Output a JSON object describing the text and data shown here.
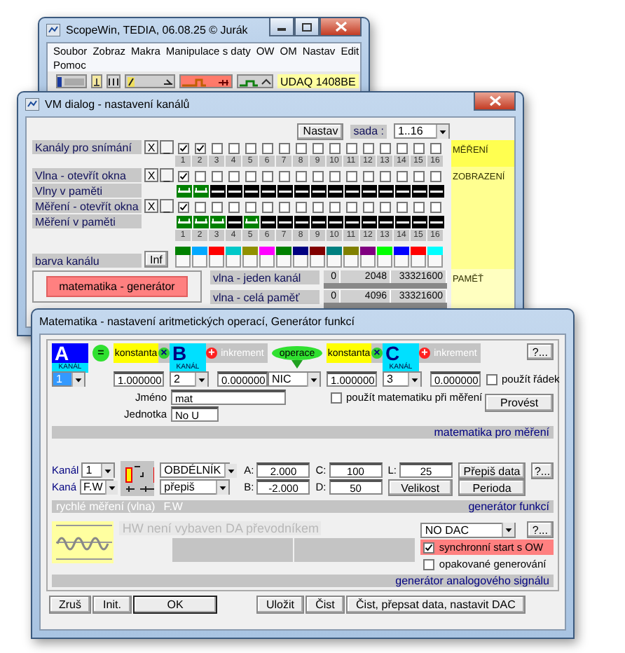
{
  "main_window": {
    "title": "ScopeWin, TEDIA,   06.08.25 © Jurák",
    "menu_rows": [
      {
        "items": [
          "Soubor",
          "Zobraz",
          "Makra",
          "Manipulace s daty",
          "OW",
          "OM",
          "Nastav",
          "Edit"
        ]
      },
      {
        "items": [
          "Pomoc"
        ]
      }
    ],
    "device": "UDAQ 1408BE"
  },
  "channels_dialog": {
    "title": "VM dialog - nastavení kanálů",
    "set_button": "Nastav",
    "set_label": "sada :",
    "set_value": "1..16",
    "rows": [
      {
        "kind": "checks",
        "label": "Kanály pro snímání",
        "buttons": [
          "X",
          "_"
        ],
        "cells": [
          {
            "checked": true
          },
          {
            "checked": true
          },
          {
            "checked": false
          },
          {
            "checked": false
          },
          {
            "checked": false
          },
          {
            "checked": false
          },
          {
            "checked": false
          },
          {
            "checked": false
          },
          {
            "checked": false
          },
          {
            "checked": false
          },
          {
            "checked": false
          },
          {
            "checked": false
          },
          {
            "checked": false
          },
          {
            "checked": false
          },
          {
            "checked": false
          },
          {
            "checked": false
          }
        ]
      },
      {
        "kind": "numbers",
        "cells": [
          {
            "text": "1"
          },
          {
            "text": "2"
          },
          {
            "text": "3"
          },
          {
            "text": "4"
          },
          {
            "text": "5"
          },
          {
            "text": "6"
          },
          {
            "text": "7"
          },
          {
            "text": "8"
          },
          {
            "text": "9"
          },
          {
            "text": "10"
          },
          {
            "text": "11"
          },
          {
            "text": "12"
          },
          {
            "text": "13"
          },
          {
            "text": "14"
          },
          {
            "text": "15"
          },
          {
            "text": "16"
          }
        ]
      },
      {
        "kind": "checks",
        "label": "Vlna - otevřít okna",
        "buttons": [
          "X",
          "_"
        ],
        "cells": [
          {
            "checked": true
          },
          {
            "checked": false
          },
          {
            "checked": false
          },
          {
            "checked": false
          },
          {
            "checked": false
          },
          {
            "checked": false
          },
          {
            "checked": false
          },
          {
            "checked": false
          },
          {
            "checked": false
          },
          {
            "checked": false
          },
          {
            "checked": false
          },
          {
            "checked": false
          },
          {
            "checked": false
          },
          {
            "checked": false
          },
          {
            "checked": false
          },
          {
            "checked": false
          }
        ]
      },
      {
        "kind": "memory",
        "label": "Vlny v paměti",
        "cells": [
          {
            "stored": true
          },
          {
            "stored": true
          },
          {
            "stored": false
          },
          {
            "stored": false
          },
          {
            "stored": false
          },
          {
            "stored": false
          },
          {
            "stored": false
          },
          {
            "stored": false
          },
          {
            "stored": false
          },
          {
            "stored": false
          },
          {
            "stored": false
          },
          {
            "stored": false
          },
          {
            "stored": false
          },
          {
            "stored": false
          },
          {
            "stored": false
          },
          {
            "stored": false
          }
        ]
      },
      {
        "kind": "checks",
        "label": "Měření - otevřít okna",
        "buttons": [
          "X",
          "_"
        ],
        "cells": [
          {
            "checked": true
          },
          {
            "checked": false
          },
          {
            "checked": false
          },
          {
            "checked": false
          },
          {
            "checked": false
          },
          {
            "checked": false
          },
          {
            "checked": false
          },
          {
            "checked": false
          },
          {
            "checked": false
          },
          {
            "checked": false
          },
          {
            "checked": false
          },
          {
            "checked": false
          },
          {
            "checked": false
          },
          {
            "checked": false
          },
          {
            "checked": false
          },
          {
            "checked": false
          }
        ]
      },
      {
        "kind": "memory",
        "label": "Měření v paměti",
        "cells": [
          {
            "stored": true
          },
          {
            "stored": true
          },
          {
            "stored": true
          },
          {
            "stored": false
          },
          {
            "stored": true
          },
          {
            "stored": false
          },
          {
            "stored": false
          },
          {
            "stored": false
          },
          {
            "stored": false
          },
          {
            "stored": false
          },
          {
            "stored": false
          },
          {
            "stored": false
          },
          {
            "stored": false
          },
          {
            "stored": false
          },
          {
            "stored": false
          },
          {
            "stored": false
          }
        ]
      },
      {
        "kind": "numbers",
        "cells": [
          {
            "text": "1"
          },
          {
            "text": "2"
          },
          {
            "text": "3"
          },
          {
            "text": "4"
          },
          {
            "text": "5"
          },
          {
            "text": "6"
          },
          {
            "text": "7"
          },
          {
            "text": "8"
          },
          {
            "text": "9"
          },
          {
            "text": "10"
          },
          {
            "text": "11"
          },
          {
            "text": "12"
          },
          {
            "text": "13"
          },
          {
            "text": "14"
          },
          {
            "text": "15"
          },
          {
            "text": "16"
          }
        ]
      },
      {
        "kind": "colors",
        "label": "barva kanálu",
        "buttons": [
          "Inf"
        ],
        "cells": [
          {
            "color": "#008000"
          },
          {
            "color": "#00a8ff"
          },
          {
            "color": "#ff0000"
          },
          {
            "color": "#00c8c8"
          },
          {
            "color": "#909000"
          },
          {
            "color": "#ff00ff"
          },
          {
            "color": "#008000"
          },
          {
            "color": "#000080"
          },
          {
            "color": "#800000"
          },
          {
            "color": "#008080"
          },
          {
            "color": "#808000"
          },
          {
            "color": "#800080"
          },
          {
            "color": "#00ff00"
          },
          {
            "color": "#0000ff"
          },
          {
            "color": "#ff0000"
          },
          {
            "color": "#00ffff"
          }
        ]
      }
    ],
    "side_panels": [
      {
        "label": "MĚŘENÍ"
      },
      {
        "label": "ZOBRAZENÍ"
      },
      {
        "label": "PAMĚŤ"
      }
    ],
    "math_button": "matematika - generátor",
    "memory": [
      {
        "label": "vlna - jeden kanál",
        "values": [
          "0",
          "2048",
          "33321600"
        ]
      },
      {
        "label": "vlna - celá paměť",
        "values": [
          "0",
          "4096",
          "33321600"
        ]
      }
    ]
  },
  "math_dialog": {
    "title": "Matematika - nastavení aritmetických operací, Generátor funkcí",
    "formula": [
      {
        "kind": "target",
        "text": "A",
        "sub": "KANÁL"
      },
      {
        "kind": "equals",
        "text": "="
      },
      {
        "kind": "constant",
        "text": "konstanta"
      },
      {
        "kind": "times",
        "text": "×"
      },
      {
        "kind": "channel",
        "text": "B",
        "sub": "KANÁL"
      },
      {
        "kind": "plus",
        "text": "+"
      },
      {
        "kind": "increment",
        "text": "inkrement"
      },
      {
        "kind": "operation",
        "text": "operace"
      },
      {
        "kind": "constant",
        "text": "konstanta"
      },
      {
        "kind": "times",
        "text": "×"
      },
      {
        "kind": "channel",
        "text": "C",
        "sub": "KANÁL"
      },
      {
        "kind": "plus",
        "text": "+"
      },
      {
        "kind": "increment",
        "text": "inkrement"
      }
    ],
    "help_button": "?...",
    "inputs": [
      {
        "kind": "select",
        "value": "1",
        "selected": true
      },
      {
        "kind": "input",
        "value": "1.000000"
      },
      {
        "kind": "select",
        "value": "2",
        "selected": false
      },
      {
        "kind": "input",
        "value": "0.000000"
      },
      {
        "kind": "select",
        "value": "NIC",
        "selected": false
      },
      {
        "kind": "input",
        "value": "1.000000"
      },
      {
        "kind": "select",
        "value": "3",
        "selected": false
      },
      {
        "kind": "input",
        "value": "0.000000"
      }
    ],
    "use_row": {
      "label": "použít řádek",
      "checked": false
    },
    "name_label": "Jméno",
    "name": "mat",
    "unit_label": "Jednotka",
    "unit": "No U",
    "use_math": {
      "label": "použít matematiku při měření",
      "checked": false
    },
    "run_button": "Provést",
    "math_bar": "matematika pro měření",
    "generator": {
      "channel_label": "Kanál",
      "channel": "1",
      "source_label": "Kaná",
      "source": "F.W",
      "shape": "OBDÉLNÍK",
      "mode": "přepiš",
      "params": [
        {
          "name": "A:",
          "value": "2.000"
        },
        {
          "name": "B:",
          "value": "-2.000"
        },
        {
          "name": "C:",
          "value": "100"
        },
        {
          "name": "D:",
          "value": "50"
        },
        {
          "name": "L:",
          "value": "25"
        }
      ],
      "buttons": [
        "Přepiš data",
        "?...",
        "Velikost",
        "Perioda"
      ],
      "bar_left": "rychlé měření (vlna)",
      "bar_mid": "F.W",
      "bar_right": "generátor funkcí"
    },
    "dac": {
      "notice": "HW není vybaven DA převodníkem",
      "select": "NO DAC",
      "help_button": "?...",
      "checks": [
        {
          "label": "synchronní start s OW",
          "checked": true,
          "alert": true
        },
        {
          "label": "opakované generování",
          "checked": false,
          "alert": false
        }
      ],
      "bar": "generátor analogového signálu"
    },
    "footer": [
      {
        "label": "Zruš",
        "kind": "left",
        "default": false
      },
      {
        "label": "Init.",
        "kind": "left",
        "default": false
      },
      {
        "label": "OK",
        "kind": "left",
        "default": true
      },
      {
        "label": "Uložit",
        "kind": "right",
        "default": false
      },
      {
        "label": "Čist",
        "kind": "right",
        "default": false
      },
      {
        "label": "Čist, přepsat data, nastavit DAC",
        "kind": "right",
        "default": false
      }
    ]
  }
}
